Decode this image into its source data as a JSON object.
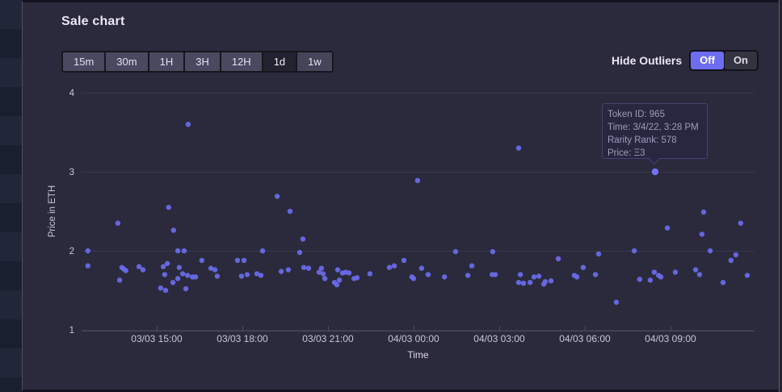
{
  "panel": {
    "title": "Sale chart"
  },
  "time_range_buttons": [
    {
      "label": "15m",
      "selected": false
    },
    {
      "label": "30m",
      "selected": false
    },
    {
      "label": "1H",
      "selected": false
    },
    {
      "label": "3H",
      "selected": false
    },
    {
      "label": "12H",
      "selected": false
    },
    {
      "label": "1d",
      "selected": true
    },
    {
      "label": "1w",
      "selected": false
    }
  ],
  "outliers": {
    "label": "Hide Outliers",
    "off_label": "Off",
    "on_label": "On",
    "active": "Off"
  },
  "tooltip": {
    "lines": [
      "Token ID: 965",
      "Time: 3/4/22, 3:28 PM",
      "Rarity Rank: 578",
      "Price: Ξ3"
    ]
  },
  "colors": {
    "accent": "#6e6df2",
    "dot": "#6b6aeb",
    "dot_highlight": "#7573f3",
    "panel_bg": "#2b2a3c",
    "grid": "#3a394b",
    "axis": "#4b4a5e",
    "axis_text": "#c7c5d8",
    "axis_title": "#dbd9e6",
    "tooltip_border": "#434275"
  },
  "chart_data": {
    "type": "scatter",
    "title": "Sale chart",
    "xlabel": "Time",
    "ylabel": "Price in ETH",
    "ylim": [
      1,
      4
    ],
    "y_ticks": [
      1,
      2,
      3,
      4
    ],
    "x_ticks": [
      {
        "h": 3,
        "label": "03/03 15:00"
      },
      {
        "h": 6,
        "label": "03/03 18:00"
      },
      {
        "h": 9,
        "label": "03/03 21:00"
      },
      {
        "h": 12,
        "label": "04/03 00:00"
      },
      {
        "h": 15,
        "label": "04/03 03:00"
      },
      {
        "h": 18,
        "label": "04/03 06:00"
      },
      {
        "h": 21,
        "label": "04/03 09:00"
      }
    ],
    "x_unit": "hours since 03/03 12:00",
    "points": [
      [
        0.59,
        2.0
      ],
      [
        0.59,
        1.81
      ],
      [
        1.64,
        2.35
      ],
      [
        1.7,
        1.63
      ],
      [
        1.78,
        1.79
      ],
      [
        1.84,
        1.77
      ],
      [
        1.92,
        1.75
      ],
      [
        2.38,
        1.8
      ],
      [
        2.52,
        1.76
      ],
      [
        3.14,
        1.53
      ],
      [
        3.23,
        1.8
      ],
      [
        3.28,
        1.7
      ],
      [
        3.31,
        1.5
      ],
      [
        3.37,
        1.84
      ],
      [
        3.42,
        2.55
      ],
      [
        3.57,
        1.6
      ],
      [
        3.59,
        2.26
      ],
      [
        3.74,
        2.0
      ],
      [
        3.74,
        1.65
      ],
      [
        3.79,
        1.79
      ],
      [
        3.91,
        1.71
      ],
      [
        3.96,
        2.0
      ],
      [
        4.02,
        1.52
      ],
      [
        4.08,
        1.69
      ],
      [
        4.1,
        3.6
      ],
      [
        4.25,
        1.67
      ],
      [
        4.36,
        1.67
      ],
      [
        4.58,
        1.88
      ],
      [
        4.9,
        1.78
      ],
      [
        5.04,
        1.76
      ],
      [
        5.12,
        1.68
      ],
      [
        5.83,
        1.88
      ],
      [
        5.97,
        1.68
      ],
      [
        6.06,
        1.88
      ],
      [
        6.17,
        1.7
      ],
      [
        6.51,
        1.71
      ],
      [
        6.65,
        1.69
      ],
      [
        6.71,
        2.0
      ],
      [
        7.22,
        2.69
      ],
      [
        7.36,
        1.74
      ],
      [
        7.61,
        1.76
      ],
      [
        7.67,
        2.5
      ],
      [
        8.01,
        1.98
      ],
      [
        8.12,
        2.15
      ],
      [
        8.15,
        1.79
      ],
      [
        8.32,
        1.78
      ],
      [
        8.69,
        1.73
      ],
      [
        8.77,
        1.78
      ],
      [
        8.83,
        1.71
      ],
      [
        8.89,
        1.65
      ],
      [
        9.23,
        1.6
      ],
      [
        9.31,
        1.57
      ],
      [
        9.34,
        1.76
      ],
      [
        9.4,
        1.63
      ],
      [
        9.51,
        1.72
      ],
      [
        9.62,
        1.73
      ],
      [
        9.74,
        1.72
      ],
      [
        9.91,
        1.65
      ],
      [
        10.02,
        1.66
      ],
      [
        10.47,
        1.71
      ],
      [
        11.15,
        1.79
      ],
      [
        11.32,
        1.81
      ],
      [
        11.66,
        1.88
      ],
      [
        11.94,
        1.67
      ],
      [
        12.0,
        1.65
      ],
      [
        12.14,
        2.89
      ],
      [
        12.28,
        1.78
      ],
      [
        12.51,
        1.7
      ],
      [
        13.08,
        1.67
      ],
      [
        13.47,
        1.99
      ],
      [
        13.9,
        1.69
      ],
      [
        14.04,
        1.81
      ],
      [
        14.75,
        1.7
      ],
      [
        14.77,
        1.99
      ],
      [
        14.86,
        1.7
      ],
      [
        15.68,
        3.3
      ],
      [
        15.68,
        1.6
      ],
      [
        15.74,
        1.7
      ],
      [
        15.85,
        1.59
      ],
      [
        16.08,
        1.6
      ],
      [
        16.22,
        1.67
      ],
      [
        16.39,
        1.68
      ],
      [
        16.56,
        1.58
      ],
      [
        16.61,
        1.61
      ],
      [
        16.81,
        1.62
      ],
      [
        17.07,
        1.9
      ],
      [
        17.63,
        1.69
      ],
      [
        17.72,
        1.67
      ],
      [
        17.94,
        1.79
      ],
      [
        18.37,
        1.7
      ],
      [
        18.48,
        1.96
      ],
      [
        19.1,
        1.35
      ],
      [
        19.73,
        2.0
      ],
      [
        19.92,
        1.64
      ],
      [
        20.29,
        1.63
      ],
      [
        20.43,
        1.73
      ],
      [
        20.58,
        1.69
      ],
      [
        20.66,
        1.67
      ],
      [
        20.89,
        2.29
      ],
      [
        21.17,
        1.73
      ],
      [
        21.88,
        1.76
      ],
      [
        22.02,
        1.7
      ],
      [
        22.1,
        2.21
      ],
      [
        22.16,
        2.49
      ],
      [
        22.39,
        2.0
      ],
      [
        22.84,
        1.6
      ],
      [
        23.12,
        1.88
      ],
      [
        23.29,
        1.95
      ],
      [
        23.46,
        2.35
      ],
      [
        23.69,
        1.69
      ]
    ],
    "highlighted_point": {
      "h": 20.46,
      "price": 3.0
    }
  }
}
